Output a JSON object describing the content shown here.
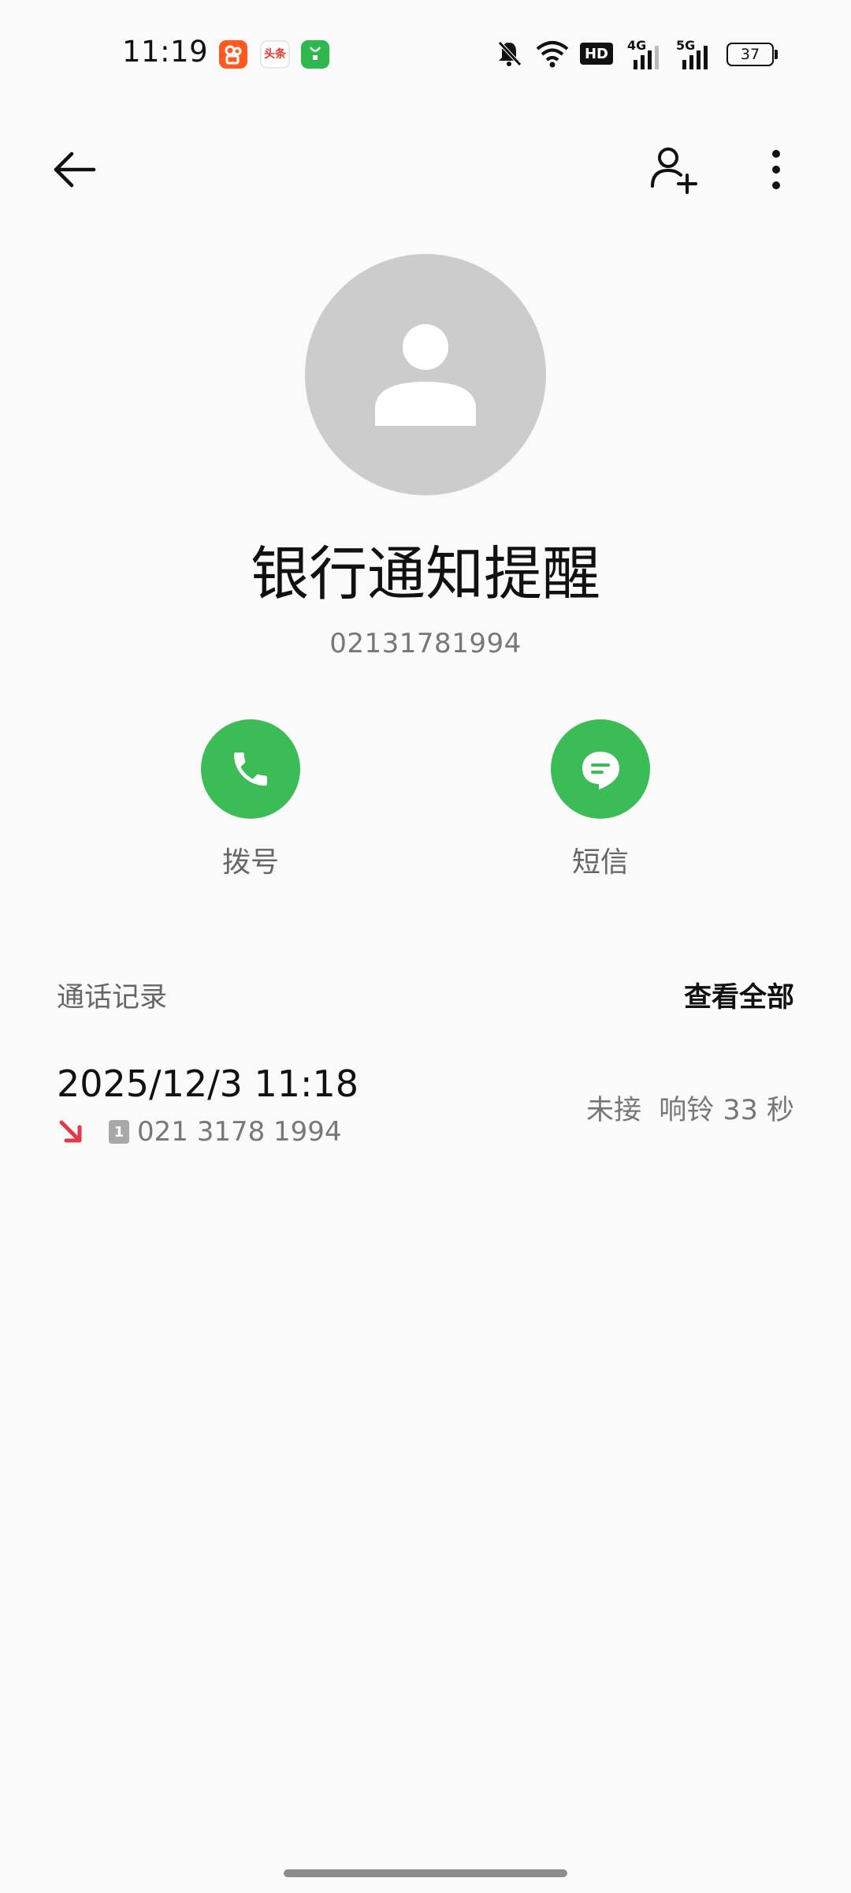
{
  "status_bar": {
    "time": "11:19",
    "apps": [
      "kuaishou-icon",
      "toutiao-icon",
      "app-store-icon"
    ],
    "toutiao_label": "头条",
    "network_hd": "HD",
    "network_4g": "4G",
    "network_5g": "5G",
    "battery": "37"
  },
  "contact": {
    "name": "银行通知提醒",
    "number": "02131781994"
  },
  "actions": {
    "call_label": "拨号",
    "sms_label": "短信"
  },
  "call_log": {
    "title": "通话记录",
    "view_all": "查看全部",
    "entries": [
      {
        "datetime": "2025/12/3 11:18",
        "sim": "1",
        "number": "021 3178 1994",
        "status": "未接  响铃 33 秒"
      }
    ]
  },
  "colors": {
    "accent_green": "#3cbc56",
    "missed_red": "#e0394a",
    "avatar_gray": "#cccccc"
  }
}
